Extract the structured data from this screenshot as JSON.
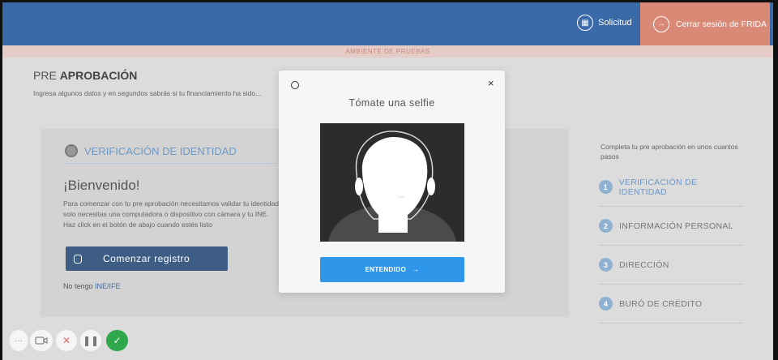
{
  "topbar": {
    "solicitud_label": "Solicitud",
    "logout_label": "Cerrar sesión de FRIDA",
    "env_label": "AMBIENTE DE PRUEBAS"
  },
  "page": {
    "title_pre": "PRE ",
    "title_bold": "APROBACIÓN",
    "subtitle": "Ingresa algunos datos y en segundos sabrás si tu financiamiento ha sido..."
  },
  "card": {
    "heading": "VERIFICACIÓN DE IDENTIDAD",
    "welcome": "¡Bienvenido!",
    "paragraph": "Para comenzar con tu pre aprobación necesitamos validar tu identidad, solo necesitas una computadora o dispositivo con cámara y tu INE. Haz click en el botón de abajo cuando estés listo",
    "start_button": "Comenzar registro",
    "no_ine_prefix": "No tengo ",
    "no_ine_link": "INE/IFE"
  },
  "steps": {
    "intro": "Completa tu pre aprobación en unos cuantos pasos",
    "items": [
      {
        "num": "1",
        "label": "VERIFICACIÓN DE IDENTIDAD"
      },
      {
        "num": "2",
        "label": "INFORMACIÓN PERSONAL"
      },
      {
        "num": "3",
        "label": "DIRECCIÓN"
      },
      {
        "num": "4",
        "label": "BURÓ DE CRÉDITO"
      }
    ]
  },
  "modal": {
    "close_symbol": "×",
    "title": "Tómate una selfie",
    "button_label": "ENTENDIDO",
    "button_arrow": "→"
  },
  "controls": {
    "more": "···",
    "x": "✕",
    "pause": "❚❚",
    "check": "✓"
  },
  "colors": {
    "topbar": "#3a6aa8",
    "logout": "#d98a76",
    "primary_button": "#2f97ea",
    "start_button": "#3e5d85",
    "accent": "#6c98c8",
    "confirm": "#2ea84a"
  }
}
